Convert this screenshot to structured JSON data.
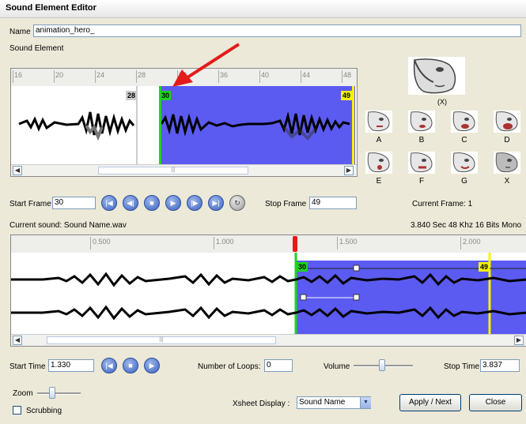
{
  "window": {
    "title": "Sound Element Editor"
  },
  "name_field": {
    "label": "Name",
    "value": "animation_hero_"
  },
  "section": {
    "label": "Sound Element"
  },
  "top_ruler": {
    "ticks": [
      "16",
      "20",
      "24",
      "28",
      "32",
      "36",
      "40",
      "44",
      "48"
    ]
  },
  "top_wave": {
    "frame_end_label": "28",
    "sel_start": "30",
    "sel_end": "49"
  },
  "lipsync": {
    "preview_label": "(X)",
    "shapes": [
      "A",
      "B",
      "C",
      "D",
      "E",
      "F",
      "G",
      "X"
    ]
  },
  "controls": {
    "start_frame_label": "Start Frame",
    "start_frame_value": "30",
    "stop_frame_label": "Stop Frame",
    "stop_frame_value": "49",
    "current_frame": "Current Frame: 1"
  },
  "current_sound": {
    "label": "Current sound: Sound Name.wav",
    "info": "3.840 Sec 48 Khz 16  Bits Mono"
  },
  "bottom_ruler": {
    "ticks": [
      "0.500",
      "1.000",
      "1.500",
      "2.000"
    ]
  },
  "bottom_wave": {
    "sel_start": "30",
    "sel_end": "49"
  },
  "time_controls": {
    "start_time_label": "Start Time",
    "start_time_value": "1.330",
    "loops_label": "Number of Loops:",
    "loops_value": "0",
    "volume_label": "Volume",
    "stop_time_label": "Stop Time",
    "stop_time_value": "3.837"
  },
  "footer": {
    "zoom_label": "Zoom",
    "scrubbing_label": "Scrubbing",
    "xsheet_label": "Xsheet Display :",
    "xsheet_value": "Sound Name",
    "apply_label": "Apply / Next",
    "close_label": "Close"
  },
  "colors": {
    "selection": "#5b5bf2",
    "playhead": "#e31b1b",
    "arrow": "#e31b1b",
    "start_marker": "#1ed31e",
    "end_marker": "#f4f400"
  }
}
